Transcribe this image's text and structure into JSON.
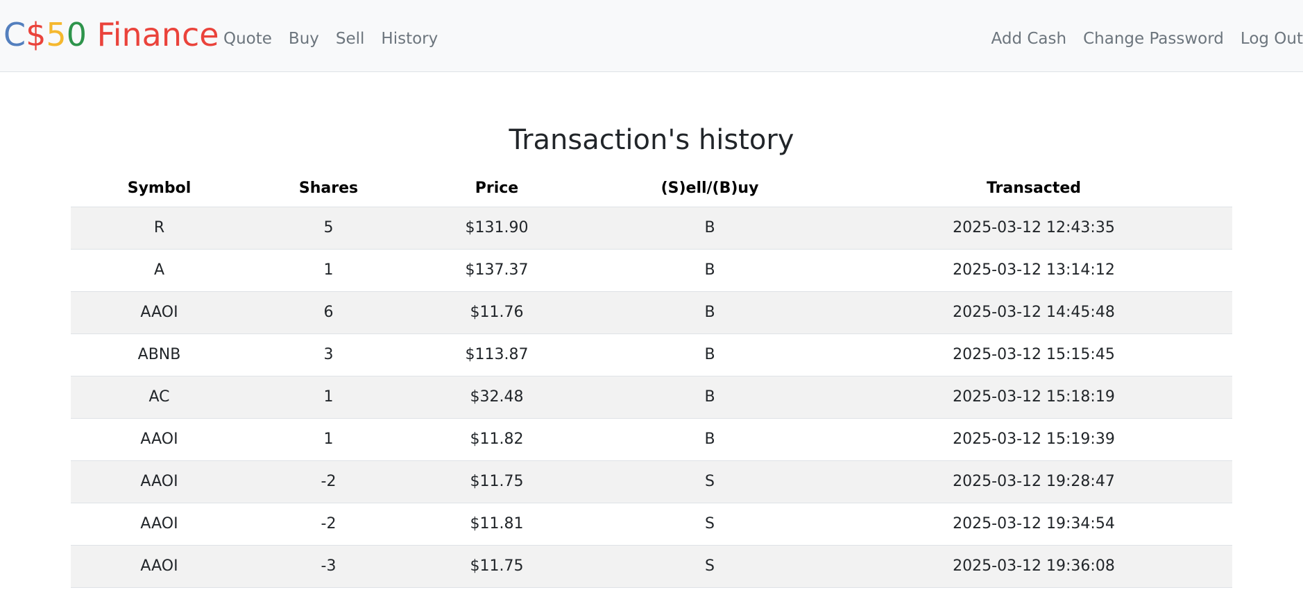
{
  "navbar": {
    "brand": {
      "parts": [
        {
          "text": "C",
          "color": "#537fbe"
        },
        {
          "text": "$",
          "color": "#ea433b"
        },
        {
          "text": "5",
          "color": "#f5b82e"
        },
        {
          "text": "0",
          "color": "#2e944b"
        },
        {
          "text": " Finance",
          "color": "#ea433b"
        }
      ]
    },
    "left_links": [
      "Quote",
      "Buy",
      "Sell",
      "History"
    ],
    "right_links": [
      "Add Cash",
      "Change Password",
      "Log Out"
    ]
  },
  "page": {
    "title": "Transaction's history"
  },
  "table": {
    "headers": [
      "Symbol",
      "Shares",
      "Price",
      "(S)ell/(B)uy",
      "Transacted"
    ],
    "rows": [
      [
        "R",
        "5",
        "$131.90",
        "B",
        "2025-03-12 12:43:35"
      ],
      [
        "A",
        "1",
        "$137.37",
        "B",
        "2025-03-12 13:14:12"
      ],
      [
        "AAOI",
        "6",
        "$11.76",
        "B",
        "2025-03-12 14:45:48"
      ],
      [
        "ABNB",
        "3",
        "$113.87",
        "B",
        "2025-03-12 15:15:45"
      ],
      [
        "AC",
        "1",
        "$32.48",
        "B",
        "2025-03-12 15:18:19"
      ],
      [
        "AAOI",
        "1",
        "$11.82",
        "B",
        "2025-03-12 15:19:39"
      ],
      [
        "AAOI",
        "-2",
        "$11.75",
        "S",
        "2025-03-12 19:28:47"
      ],
      [
        "AAOI",
        "-2",
        "$11.81",
        "S",
        "2025-03-12 19:34:54"
      ],
      [
        "AAOI",
        "-3",
        "$11.75",
        "S",
        "2025-03-12 19:36:08"
      ]
    ]
  }
}
